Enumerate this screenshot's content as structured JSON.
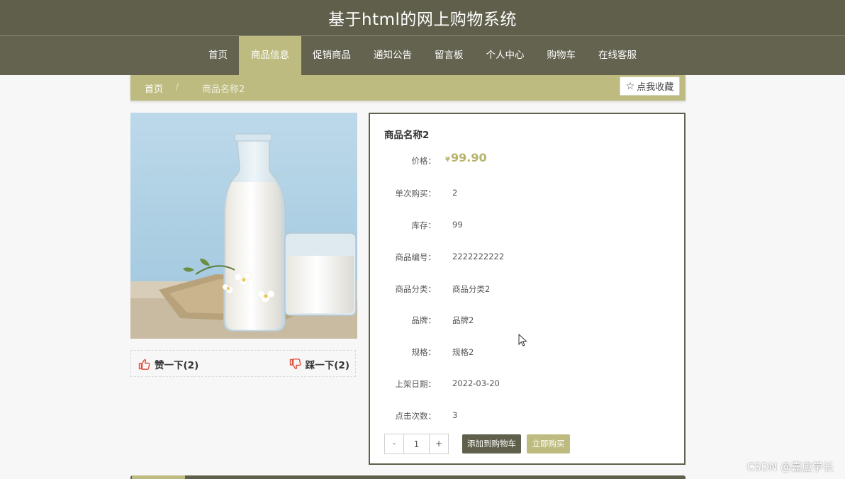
{
  "header": {
    "site_title": "基于html的网上购物系统"
  },
  "nav": {
    "items": [
      {
        "label": "首页"
      },
      {
        "label": "商品信息",
        "active": true
      },
      {
        "label": "促销商品"
      },
      {
        "label": "通知公告"
      },
      {
        "label": "留言板"
      },
      {
        "label": "个人中心"
      },
      {
        "label": "购物车"
      },
      {
        "label": "在线客服"
      }
    ]
  },
  "breadcrumb": {
    "home": "首页",
    "separator": "/",
    "current": "商品名称2"
  },
  "favorite": {
    "label": "点我收藏",
    "icon": "star-outline-icon"
  },
  "votes": {
    "like_label": "赞一下(2)",
    "like_icon": "thumbs-up-icon",
    "dislike_label": "踩一下(2)",
    "dislike_icon": "thumbs-down-icon"
  },
  "product": {
    "name": "商品名称2",
    "price_label": "价格：",
    "currency": "¥",
    "price": "99.90",
    "fields": [
      {
        "label": "单次购买：",
        "value": "2"
      },
      {
        "label": "库存：",
        "value": "99"
      },
      {
        "label": "商品编号：",
        "value": "2222222222"
      },
      {
        "label": "商品分类：",
        "value": "商品分类2"
      },
      {
        "label": "品牌：",
        "value": "品牌2"
      },
      {
        "label": "规格：",
        "value": "规格2"
      },
      {
        "label": "上架日期：",
        "value": "2022-03-20"
      },
      {
        "label": "点击次数：",
        "value": "3"
      }
    ]
  },
  "purchase": {
    "minus": "-",
    "quantity": "1",
    "plus": "+",
    "add_to_cart": "添加到购物车",
    "buy_now": "立即购买"
  },
  "watermark": "CSDN @嘉应学长",
  "colors": {
    "dark": "#5f5f4b",
    "accent": "#bdbb7f",
    "price": "#b6b36b",
    "like": "#e0503f"
  }
}
